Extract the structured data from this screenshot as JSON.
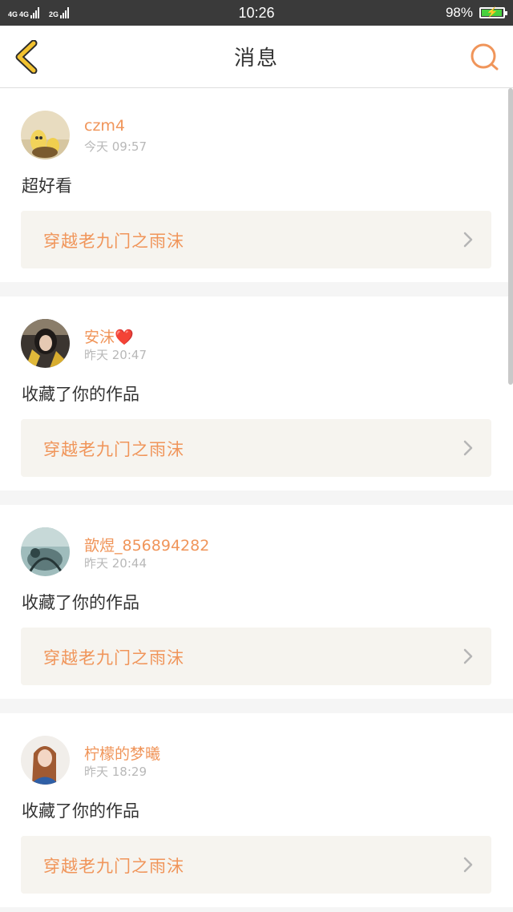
{
  "status_bar": {
    "network_left": "4G",
    "network_left2": "4G",
    "network_right": "2G",
    "time": "10:26",
    "battery": "98%",
    "battery_level": 0.98
  },
  "header": {
    "title": "消息"
  },
  "messages": [
    {
      "username": "czm4",
      "time": "今天 09:57",
      "content": "超好看",
      "work_title": "穿越老九门之雨沫"
    },
    {
      "username": "安沫❤️",
      "time": "昨天 20:47",
      "content": "收藏了你的作品",
      "work_title": "穿越老九门之雨沫"
    },
    {
      "username": "歆煜_856894282",
      "time": "昨天 20:44",
      "content": "收藏了你的作品",
      "work_title": "穿越老九门之雨沫"
    },
    {
      "username": "柠檬的梦曦",
      "time": "昨天 18:29",
      "content": "收藏了你的作品",
      "work_title": "穿越老九门之雨沫"
    }
  ],
  "colors": {
    "accent": "#f0955a",
    "back_icon": "#f2c230",
    "status_bar_bg": "#3a3a3a",
    "card_link_bg": "#f6f4ef"
  }
}
